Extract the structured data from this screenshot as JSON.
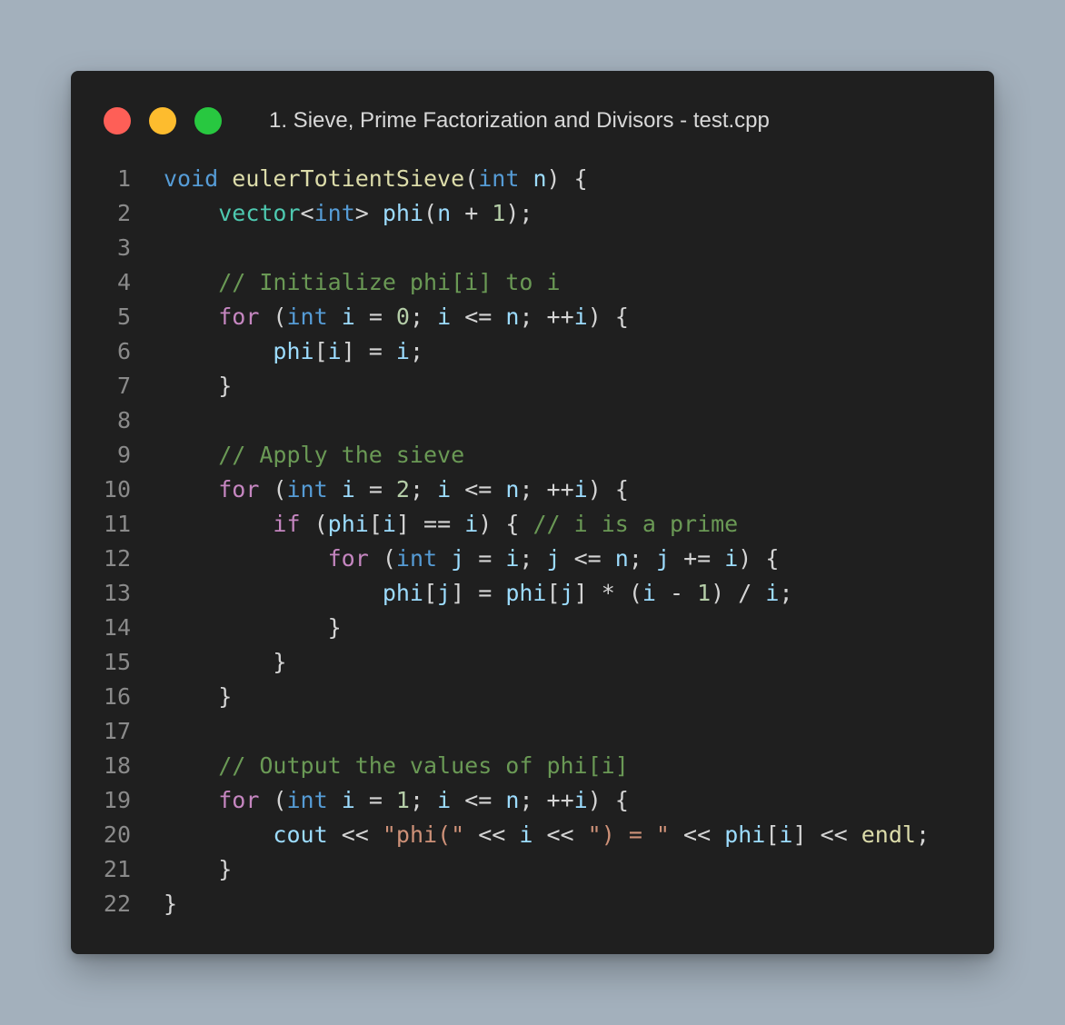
{
  "window": {
    "title": "1. Sieve, Prime Factorization and Divisors - test.cpp",
    "controls": {
      "close_color": "#fe5f57",
      "minimize_color": "#fdbc2e",
      "maximize_color": "#28c840"
    }
  },
  "editor": {
    "language": "cpp",
    "lines": [
      {
        "number": "1",
        "tokens": [
          {
            "t": "void",
            "c": "kw"
          },
          {
            "t": " ",
            "c": "pun"
          },
          {
            "t": "eulerTotientSieve",
            "c": "fn"
          },
          {
            "t": "(",
            "c": "pun"
          },
          {
            "t": "int",
            "c": "kw"
          },
          {
            "t": " ",
            "c": "pun"
          },
          {
            "t": "n",
            "c": "var"
          },
          {
            "t": ") {",
            "c": "pun"
          }
        ]
      },
      {
        "number": "2",
        "tokens": [
          {
            "t": "    ",
            "c": "pun"
          },
          {
            "t": "vector",
            "c": "typ"
          },
          {
            "t": "<",
            "c": "pun"
          },
          {
            "t": "int",
            "c": "kw"
          },
          {
            "t": "> ",
            "c": "pun"
          },
          {
            "t": "phi",
            "c": "var"
          },
          {
            "t": "(",
            "c": "pun"
          },
          {
            "t": "n",
            "c": "var"
          },
          {
            "t": " + ",
            "c": "pun"
          },
          {
            "t": "1",
            "c": "num"
          },
          {
            "t": ");",
            "c": "pun"
          }
        ]
      },
      {
        "number": "3",
        "tokens": []
      },
      {
        "number": "4",
        "tokens": [
          {
            "t": "    ",
            "c": "pun"
          },
          {
            "t": "// Initialize phi[i] to i",
            "c": "com"
          }
        ]
      },
      {
        "number": "5",
        "tokens": [
          {
            "t": "    ",
            "c": "pun"
          },
          {
            "t": "for",
            "c": "ctl"
          },
          {
            "t": " (",
            "c": "pun"
          },
          {
            "t": "int",
            "c": "kw"
          },
          {
            "t": " ",
            "c": "pun"
          },
          {
            "t": "i",
            "c": "var"
          },
          {
            "t": " = ",
            "c": "pun"
          },
          {
            "t": "0",
            "c": "num"
          },
          {
            "t": "; ",
            "c": "pun"
          },
          {
            "t": "i",
            "c": "var"
          },
          {
            "t": " <= ",
            "c": "pun"
          },
          {
            "t": "n",
            "c": "var"
          },
          {
            "t": "; ++",
            "c": "pun"
          },
          {
            "t": "i",
            "c": "var"
          },
          {
            "t": ") {",
            "c": "pun"
          }
        ]
      },
      {
        "number": "6",
        "tokens": [
          {
            "t": "        ",
            "c": "pun"
          },
          {
            "t": "phi",
            "c": "var"
          },
          {
            "t": "[",
            "c": "pun"
          },
          {
            "t": "i",
            "c": "var"
          },
          {
            "t": "] = ",
            "c": "pun"
          },
          {
            "t": "i",
            "c": "var"
          },
          {
            "t": ";",
            "c": "pun"
          }
        ]
      },
      {
        "number": "7",
        "tokens": [
          {
            "t": "    }",
            "c": "pun"
          }
        ]
      },
      {
        "number": "8",
        "tokens": []
      },
      {
        "number": "9",
        "tokens": [
          {
            "t": "    ",
            "c": "pun"
          },
          {
            "t": "// Apply the sieve",
            "c": "com"
          }
        ]
      },
      {
        "number": "10",
        "tokens": [
          {
            "t": "    ",
            "c": "pun"
          },
          {
            "t": "for",
            "c": "ctl"
          },
          {
            "t": " (",
            "c": "pun"
          },
          {
            "t": "int",
            "c": "kw"
          },
          {
            "t": " ",
            "c": "pun"
          },
          {
            "t": "i",
            "c": "var"
          },
          {
            "t": " = ",
            "c": "pun"
          },
          {
            "t": "2",
            "c": "num"
          },
          {
            "t": "; ",
            "c": "pun"
          },
          {
            "t": "i",
            "c": "var"
          },
          {
            "t": " <= ",
            "c": "pun"
          },
          {
            "t": "n",
            "c": "var"
          },
          {
            "t": "; ++",
            "c": "pun"
          },
          {
            "t": "i",
            "c": "var"
          },
          {
            "t": ") {",
            "c": "pun"
          }
        ]
      },
      {
        "number": "11",
        "tokens": [
          {
            "t": "        ",
            "c": "pun"
          },
          {
            "t": "if",
            "c": "ctl"
          },
          {
            "t": " (",
            "c": "pun"
          },
          {
            "t": "phi",
            "c": "var"
          },
          {
            "t": "[",
            "c": "pun"
          },
          {
            "t": "i",
            "c": "var"
          },
          {
            "t": "] == ",
            "c": "pun"
          },
          {
            "t": "i",
            "c": "var"
          },
          {
            "t": ") { ",
            "c": "pun"
          },
          {
            "t": "// i is a prime",
            "c": "com"
          }
        ]
      },
      {
        "number": "12",
        "tokens": [
          {
            "t": "            ",
            "c": "pun"
          },
          {
            "t": "for",
            "c": "ctl"
          },
          {
            "t": " (",
            "c": "pun"
          },
          {
            "t": "int",
            "c": "kw"
          },
          {
            "t": " ",
            "c": "pun"
          },
          {
            "t": "j",
            "c": "var"
          },
          {
            "t": " = ",
            "c": "pun"
          },
          {
            "t": "i",
            "c": "var"
          },
          {
            "t": "; ",
            "c": "pun"
          },
          {
            "t": "j",
            "c": "var"
          },
          {
            "t": " <= ",
            "c": "pun"
          },
          {
            "t": "n",
            "c": "var"
          },
          {
            "t": "; ",
            "c": "pun"
          },
          {
            "t": "j",
            "c": "var"
          },
          {
            "t": " += ",
            "c": "pun"
          },
          {
            "t": "i",
            "c": "var"
          },
          {
            "t": ") {",
            "c": "pun"
          }
        ]
      },
      {
        "number": "13",
        "tokens": [
          {
            "t": "                ",
            "c": "pun"
          },
          {
            "t": "phi",
            "c": "var"
          },
          {
            "t": "[",
            "c": "pun"
          },
          {
            "t": "j",
            "c": "var"
          },
          {
            "t": "] = ",
            "c": "pun"
          },
          {
            "t": "phi",
            "c": "var"
          },
          {
            "t": "[",
            "c": "pun"
          },
          {
            "t": "j",
            "c": "var"
          },
          {
            "t": "] * (",
            "c": "pun"
          },
          {
            "t": "i",
            "c": "var"
          },
          {
            "t": " - ",
            "c": "pun"
          },
          {
            "t": "1",
            "c": "num"
          },
          {
            "t": ") / ",
            "c": "pun"
          },
          {
            "t": "i",
            "c": "var"
          },
          {
            "t": ";",
            "c": "pun"
          }
        ]
      },
      {
        "number": "14",
        "tokens": [
          {
            "t": "            }",
            "c": "pun"
          }
        ]
      },
      {
        "number": "15",
        "tokens": [
          {
            "t": "        }",
            "c": "pun"
          }
        ]
      },
      {
        "number": "16",
        "tokens": [
          {
            "t": "    }",
            "c": "pun"
          }
        ]
      },
      {
        "number": "17",
        "tokens": []
      },
      {
        "number": "18",
        "tokens": [
          {
            "t": "    ",
            "c": "pun"
          },
          {
            "t": "// Output the values of phi[i]",
            "c": "com"
          }
        ]
      },
      {
        "number": "19",
        "tokens": [
          {
            "t": "    ",
            "c": "pun"
          },
          {
            "t": "for",
            "c": "ctl"
          },
          {
            "t": " (",
            "c": "pun"
          },
          {
            "t": "int",
            "c": "kw"
          },
          {
            "t": " ",
            "c": "pun"
          },
          {
            "t": "i",
            "c": "var"
          },
          {
            "t": " = ",
            "c": "pun"
          },
          {
            "t": "1",
            "c": "num"
          },
          {
            "t": "; ",
            "c": "pun"
          },
          {
            "t": "i",
            "c": "var"
          },
          {
            "t": " <= ",
            "c": "pun"
          },
          {
            "t": "n",
            "c": "var"
          },
          {
            "t": "; ++",
            "c": "pun"
          },
          {
            "t": "i",
            "c": "var"
          },
          {
            "t": ") {",
            "c": "pun"
          }
        ]
      },
      {
        "number": "20",
        "tokens": [
          {
            "t": "        ",
            "c": "pun"
          },
          {
            "t": "cout",
            "c": "var"
          },
          {
            "t": " << ",
            "c": "pun"
          },
          {
            "t": "\"phi(\"",
            "c": "str"
          },
          {
            "t": " << ",
            "c": "pun"
          },
          {
            "t": "i",
            "c": "var"
          },
          {
            "t": " << ",
            "c": "pun"
          },
          {
            "t": "\") = \"",
            "c": "str"
          },
          {
            "t": " << ",
            "c": "pun"
          },
          {
            "t": "phi",
            "c": "var"
          },
          {
            "t": "[",
            "c": "pun"
          },
          {
            "t": "i",
            "c": "var"
          },
          {
            "t": "] << ",
            "c": "pun"
          },
          {
            "t": "endl",
            "c": "fn"
          },
          {
            "t": ";",
            "c": "pun"
          }
        ]
      },
      {
        "number": "21",
        "tokens": [
          {
            "t": "    }",
            "c": "pun"
          }
        ]
      },
      {
        "number": "22",
        "tokens": [
          {
            "t": "}",
            "c": "pun"
          }
        ]
      }
    ]
  }
}
